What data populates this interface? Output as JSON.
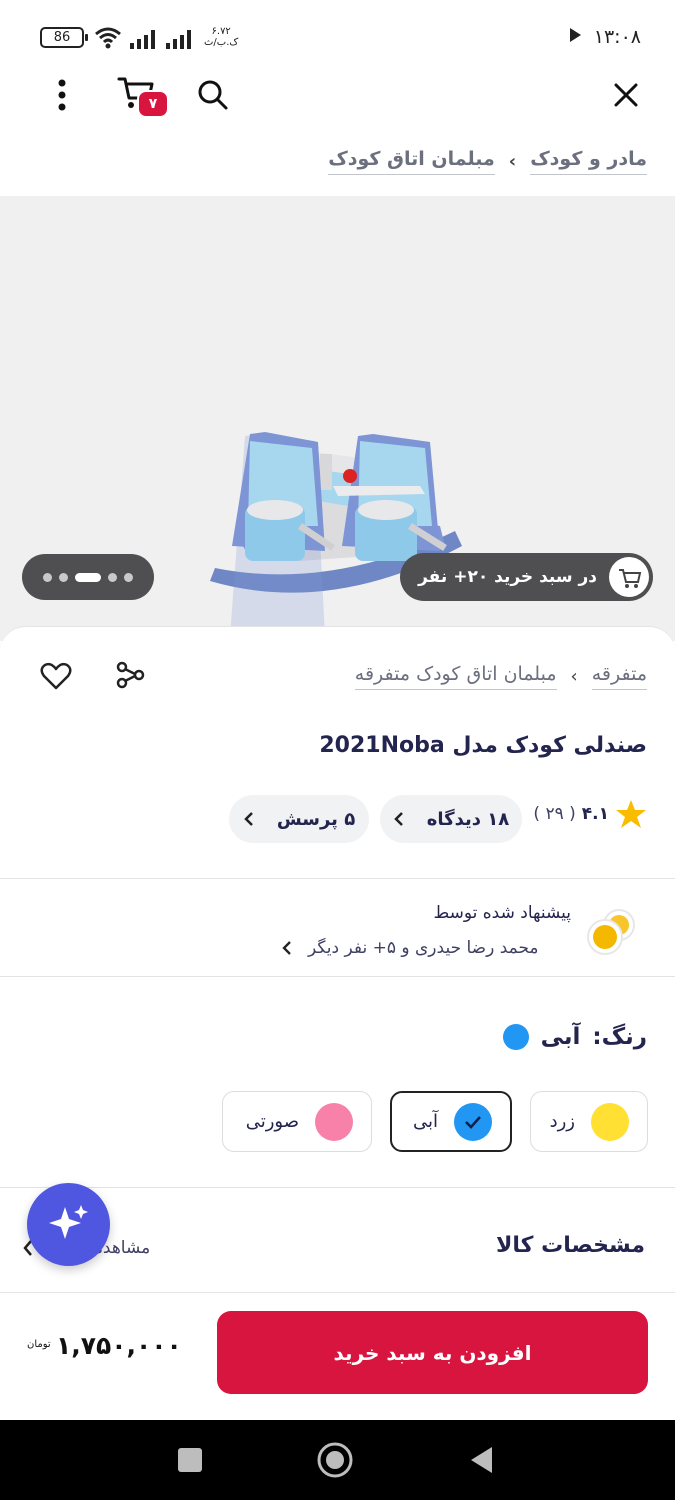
{
  "status_bar": {
    "time": "۱۳:۰۸",
    "battery": "86",
    "network_speed_value": "۶.۷۲",
    "network_speed_unit": "ک.ب/ث"
  },
  "header": {
    "cart_badge": "۷"
  },
  "breadcrumb_top": {
    "items": [
      "مادر و کودک",
      "مبلمان اتاق کودک"
    ],
    "separator": "›"
  },
  "gallery": {
    "cart_pill_text": "در سبد خرید ۲۰+ نفر",
    "dots_count": 5,
    "active_dot": 2
  },
  "product": {
    "breadcrumb": [
      "متفرقه",
      "مبلمان اتاق کودک متفرقه"
    ],
    "title": "صندلی کودک مدل 2021Noba",
    "rating": "۴.۱",
    "rating_count": "( ۲۹ )",
    "reviews_chip": "۱۸ دیدگاه",
    "questions_chip": "۵ پرسش"
  },
  "suggested": {
    "line1": "پیشنهاد شده توسط",
    "line2": "محمد رضا حیدری و ۵+ نفر دیگر"
  },
  "color": {
    "label": "رنگ:",
    "selected_name": "آبی",
    "selected_hex": "#2196f3",
    "options": [
      {
        "name": "زرد",
        "hex": "#ffe033"
      },
      {
        "name": "آبی",
        "hex": "#2196f3"
      },
      {
        "name": "صورتی",
        "hex": "#f781a9"
      }
    ]
  },
  "specs": {
    "title": "مشخصات کالا",
    "more": "مشاهده"
  },
  "buy": {
    "button": "افزودن به سبد خرید",
    "price": "۱,۷۵۰,۰۰۰",
    "currency": "تومان"
  },
  "colors": {
    "primary": "#d7153f",
    "text": "#23254e",
    "fab": "#4f57e0"
  }
}
